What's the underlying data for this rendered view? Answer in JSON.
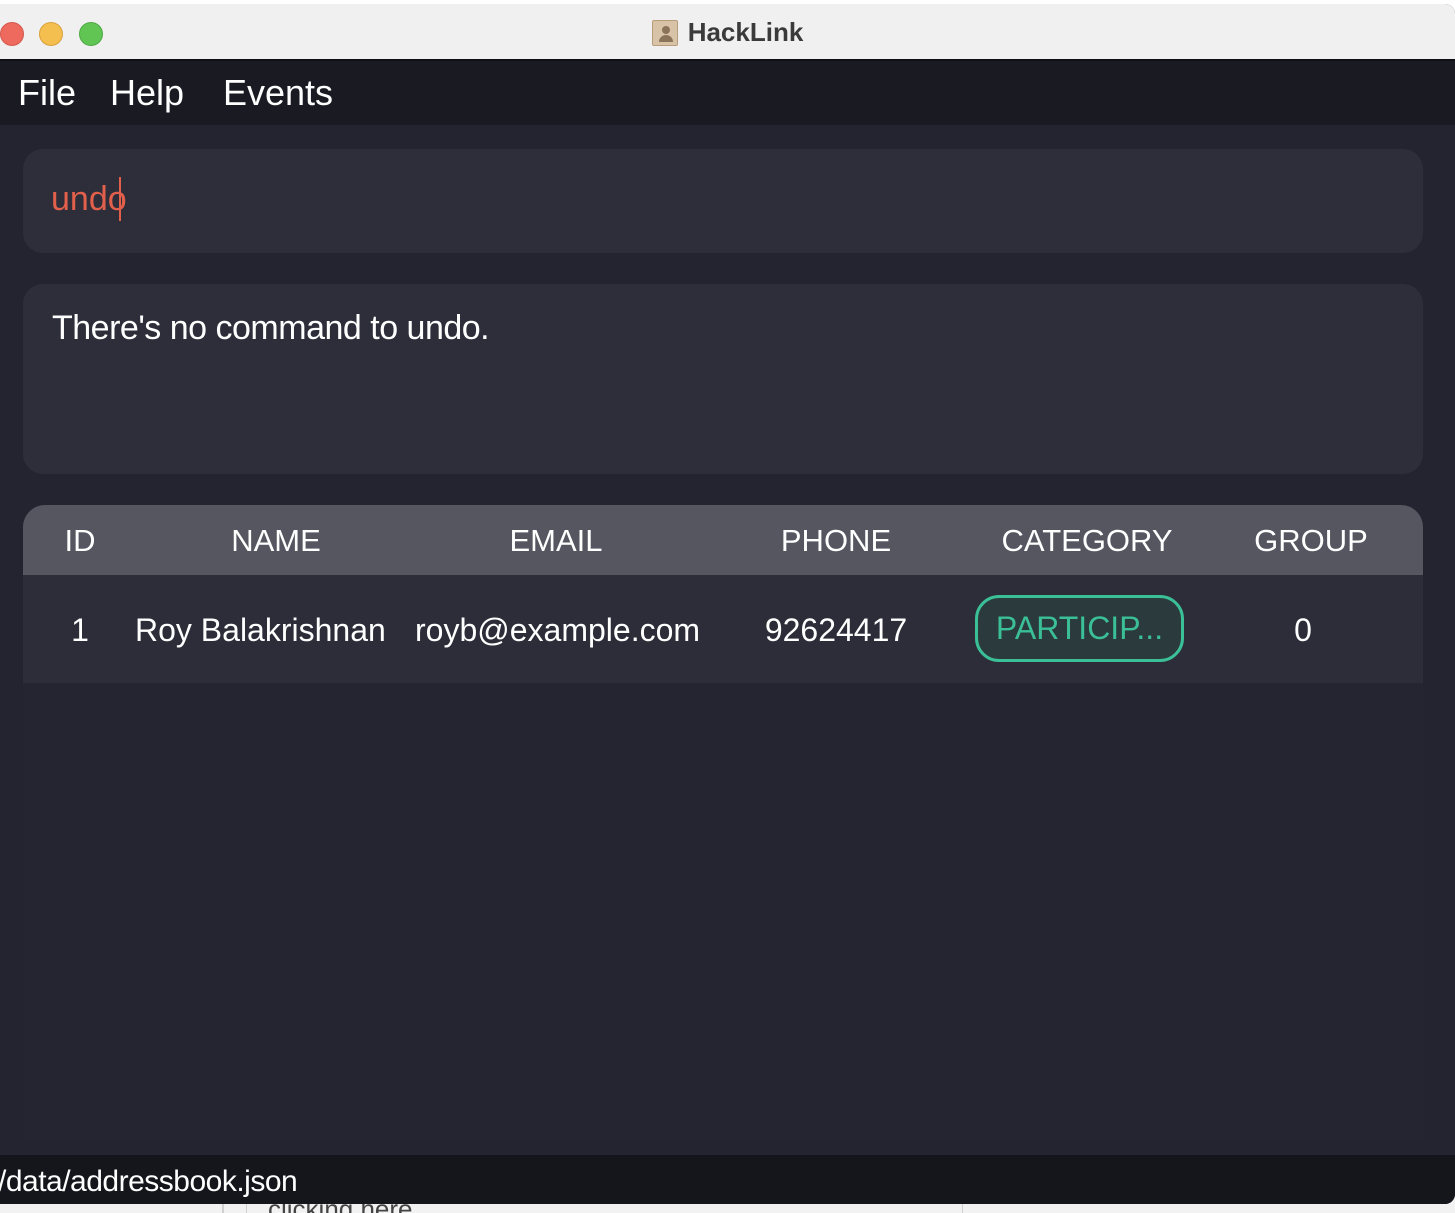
{
  "window": {
    "title": "HackLink"
  },
  "menu": {
    "file": "File",
    "help": "Help",
    "events": "Events"
  },
  "command": {
    "value": "undo"
  },
  "result": {
    "text": "There's no command to undo."
  },
  "table": {
    "headers": [
      "ID",
      "NAME",
      "EMAIL",
      "PHONE",
      "CATEGORY",
      "GROUP"
    ],
    "rows": [
      {
        "id": "1",
        "name": "Roy Balakrishnan",
        "email": "royb@example.com",
        "phone": "92624417",
        "category": "PARTICIP...",
        "group": "0"
      }
    ]
  },
  "status": {
    "path": "/data/addressbook.json"
  },
  "background_window": {
    "text": "clicking here."
  },
  "colors": {
    "accent_command": "#e2604b",
    "category_badge": "#3bbf97",
    "background": "#23242f"
  }
}
